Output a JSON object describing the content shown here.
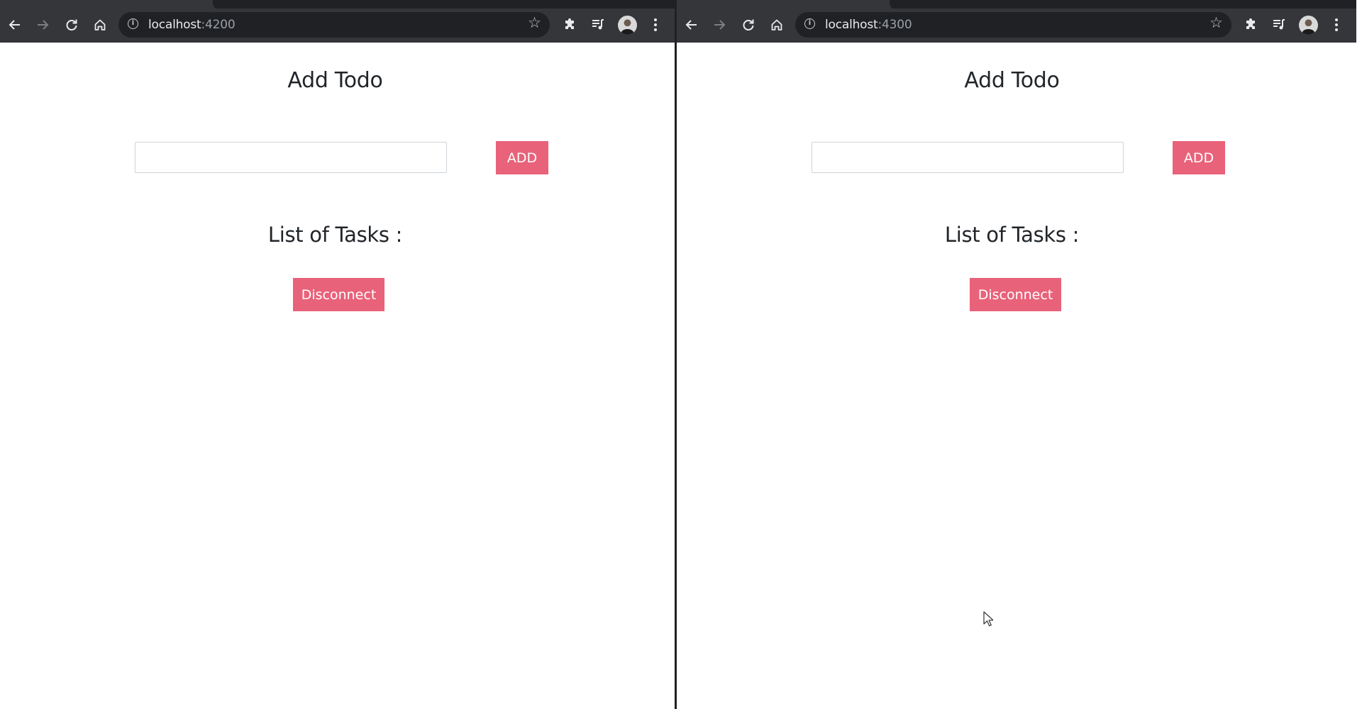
{
  "windows": [
    {
      "url": {
        "host": "localhost",
        "port": ":4200"
      },
      "page": {
        "title": "Add Todo",
        "input": {
          "value": "",
          "placeholder": ""
        },
        "add_label": "ADD",
        "list_title": "List of Tasks :",
        "disconnect_label": "Disconnect"
      }
    },
    {
      "url": {
        "host": "localhost",
        "port": ":4300"
      },
      "page": {
        "title": "Add Todo",
        "input": {
          "value": "",
          "placeholder": ""
        },
        "add_label": "ADD",
        "list_title": "List of Tasks :",
        "disconnect_label": "Disconnect"
      }
    }
  ],
  "icons": {
    "back": "back-arrow-icon",
    "forward": "forward-arrow-icon",
    "reload": "reload-icon",
    "home": "home-icon",
    "info": "site-info-icon",
    "bookmark": "star-icon",
    "extensions": "puzzle-icon",
    "media": "media-queue-icon",
    "profile": "avatar",
    "menu": "kebab-menu-icon"
  },
  "colors": {
    "browser_chrome": "#35363a",
    "omnibox": "#202124",
    "button_accent": "#e8627a",
    "heading_text": "#212529",
    "page_background": "#ffffff"
  }
}
